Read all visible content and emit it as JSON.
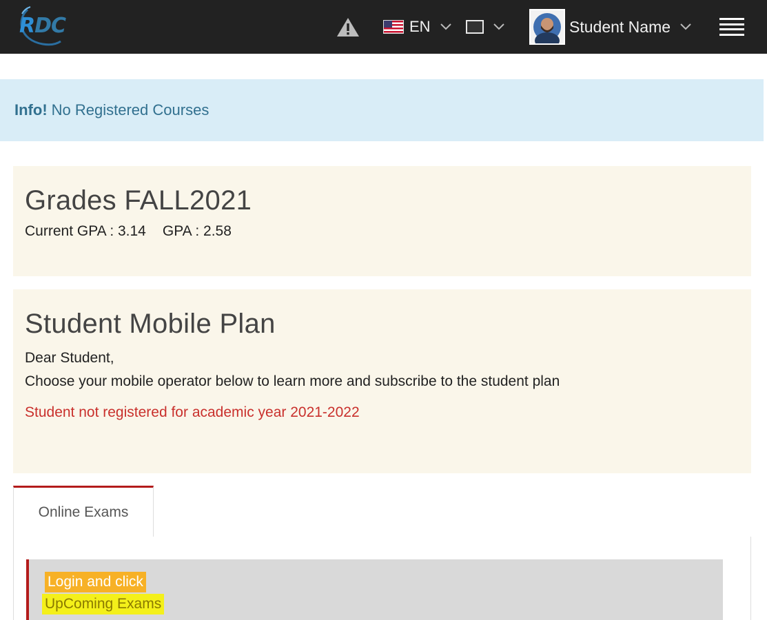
{
  "brand": {
    "logo_text": "RDC"
  },
  "header": {
    "language_code": "EN",
    "user_name": "Student Name",
    "icons": [
      "warning-icon",
      "us-flag-icon",
      "chevron-down-icon",
      "screen-icon",
      "avatar",
      "hamburger-menu-icon"
    ]
  },
  "alert": {
    "label": "Info!",
    "message": "No Registered Courses"
  },
  "grades": {
    "title": "Grades FALL2021",
    "current_gpa": "Current GPA : 3.14",
    "gpa": "GPA : 2.58"
  },
  "mobile_plan": {
    "title": "Student Mobile Plan",
    "greeting": "Dear Student,",
    "instruction": "Choose your mobile operator below to learn more and subscribe to the student plan",
    "error": "Student not registered for academic year 2021-2022"
  },
  "tabs": {
    "active": "Online Exams"
  },
  "exams": {
    "line1": "Login and click",
    "line2": "UpComing Exams"
  },
  "colors": {
    "navbar": "#222222",
    "alert_bg": "#d9edf7",
    "alert_text": "#31708f",
    "panel_bg": "#faf6ea",
    "danger": "#c9302c",
    "accent_red": "#b31b1b",
    "highlight_orange": "#f7b126",
    "highlight_yellow": "#f4f01a"
  }
}
